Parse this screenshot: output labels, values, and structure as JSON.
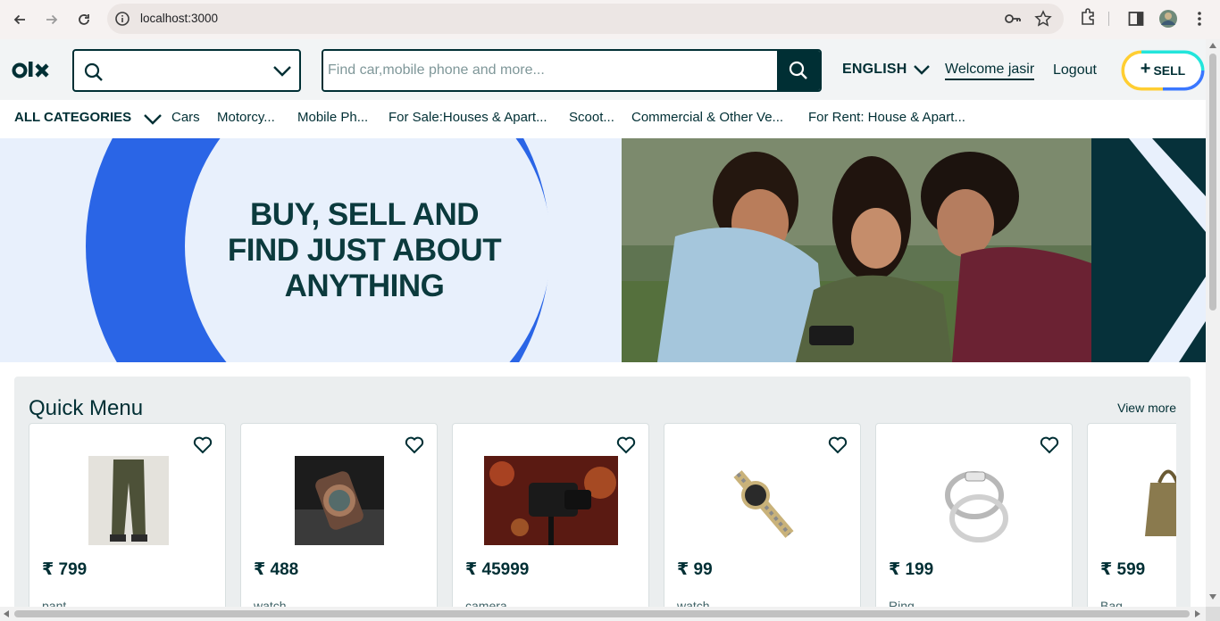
{
  "browser": {
    "url": "localhost:3000",
    "icons": [
      "back-icon",
      "forward-icon",
      "reload-icon",
      "info-icon",
      "key-icon",
      "star-icon",
      "extensions-icon",
      "side-panel-icon",
      "profile-avatar",
      "menu-icon"
    ]
  },
  "header": {
    "logo": "OLX",
    "search_placeholder": "Find car,mobile phone and more...",
    "language": "ENGLISH",
    "welcome": "Welcome jasir",
    "logout": "Logout",
    "sell_label": "SELL",
    "sell_plus": "+"
  },
  "categories": {
    "all_label": "ALL CATEGORIES",
    "items": [
      "Cars",
      "Motorcy...",
      "Mobile Ph...",
      "For Sale:Houses & Apart...",
      "Scoot...",
      "Commercial & Other Ve...",
      "For Rent: House & Apart..."
    ]
  },
  "banner": {
    "line1": "BUY, SELL AND",
    "line2": "FIND JUST ABOUT",
    "line3": "ANYTHING",
    "colors": {
      "blue": "#2a65e6",
      "light": "#e8f0fc",
      "dark": "#06313a"
    }
  },
  "quick_menu": {
    "title": "Quick Menu",
    "view_more": "View more",
    "products": [
      {
        "price": "₹ 799",
        "name": "pant"
      },
      {
        "price": "₹ 488",
        "name": "watch"
      },
      {
        "price": "₹ 45999",
        "name": "camera"
      },
      {
        "price": "₹ 99",
        "name": "watch"
      },
      {
        "price": "₹ 199",
        "name": "Ring"
      },
      {
        "price": "₹ 599",
        "name": "Bag"
      }
    ]
  }
}
